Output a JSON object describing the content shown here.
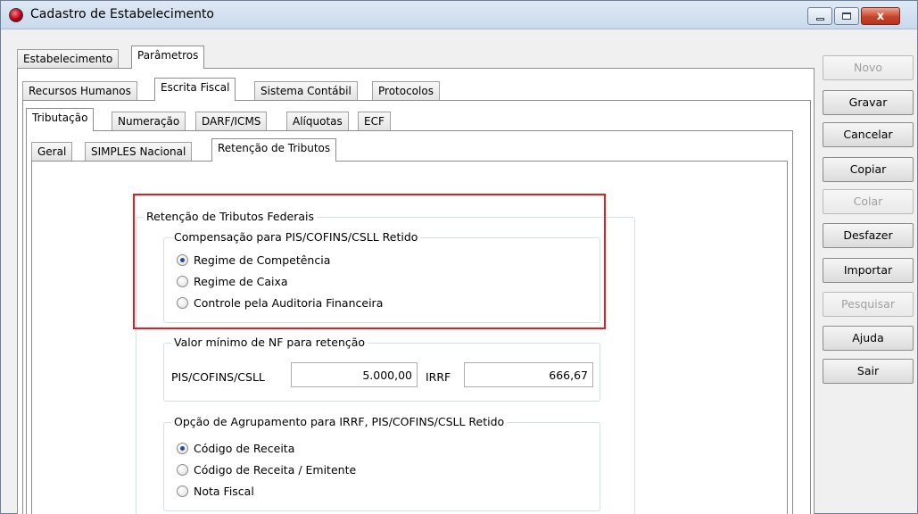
{
  "window": {
    "title": "Cadastro de Estabelecimento",
    "close_glyph": "x"
  },
  "tabs_level1": [
    {
      "label": "Estabelecimento"
    },
    {
      "label": "Parâmetros"
    }
  ],
  "tabs_level2": [
    {
      "label": "Recursos Humanos"
    },
    {
      "label": "Escrita Fiscal"
    },
    {
      "label": "Sistema Contábil"
    },
    {
      "label": "Protocolos"
    }
  ],
  "tabs_level3": [
    {
      "label": "Tributação"
    },
    {
      "label": "Numeração"
    },
    {
      "label": "DARF/ICMS"
    },
    {
      "label": "Alíquotas"
    },
    {
      "label": "ECF"
    }
  ],
  "tabs_level4": [
    {
      "label": "Geral"
    },
    {
      "label": "SIMPLES Nacional"
    },
    {
      "label": "Retenção de Tributos"
    }
  ],
  "retencao": {
    "group_title": "Retenção de Tributos Federais",
    "compensacao": {
      "title": "Compensação para PIS/COFINS/CSLL Retido",
      "options": [
        {
          "label": "Regime de Competência",
          "checked": true
        },
        {
          "label": "Regime de Caixa",
          "checked": false
        },
        {
          "label": "Controle pela Auditoria Financeira",
          "checked": false
        }
      ]
    },
    "valor_minimo": {
      "title": "Valor mínimo de NF para retenção",
      "pis_label": "PIS/COFINS/CSLL",
      "pis_value": "5.000,00",
      "irrf_label": "IRRF",
      "irrf_value": "666,67"
    },
    "agrupamento": {
      "title": "Opção de Agrupamento para IRRF, PIS/COFINS/CSLL Retido",
      "options": [
        {
          "label": "Código de Receita",
          "checked": true
        },
        {
          "label": "Código de Receita / Emitente",
          "checked": false
        },
        {
          "label": "Nota Fiscal",
          "checked": false
        }
      ]
    }
  },
  "side_buttons": [
    {
      "label": "Novo",
      "enabled": false
    },
    {
      "label": "Gravar",
      "enabled": true
    },
    {
      "label": "Cancelar",
      "enabled": true
    },
    {
      "label": "Copiar",
      "enabled": true
    },
    {
      "label": "Colar",
      "enabled": false
    },
    {
      "label": "Desfazer",
      "enabled": true
    },
    {
      "label": "Importar",
      "enabled": true
    },
    {
      "label": "Pesquisar",
      "enabled": false
    },
    {
      "label": "Ajuda",
      "enabled": true
    },
    {
      "label": "Sair",
      "enabled": true
    }
  ],
  "colors": {
    "highlight_box": "#e02020",
    "radio_dot": "#1d4f91"
  }
}
